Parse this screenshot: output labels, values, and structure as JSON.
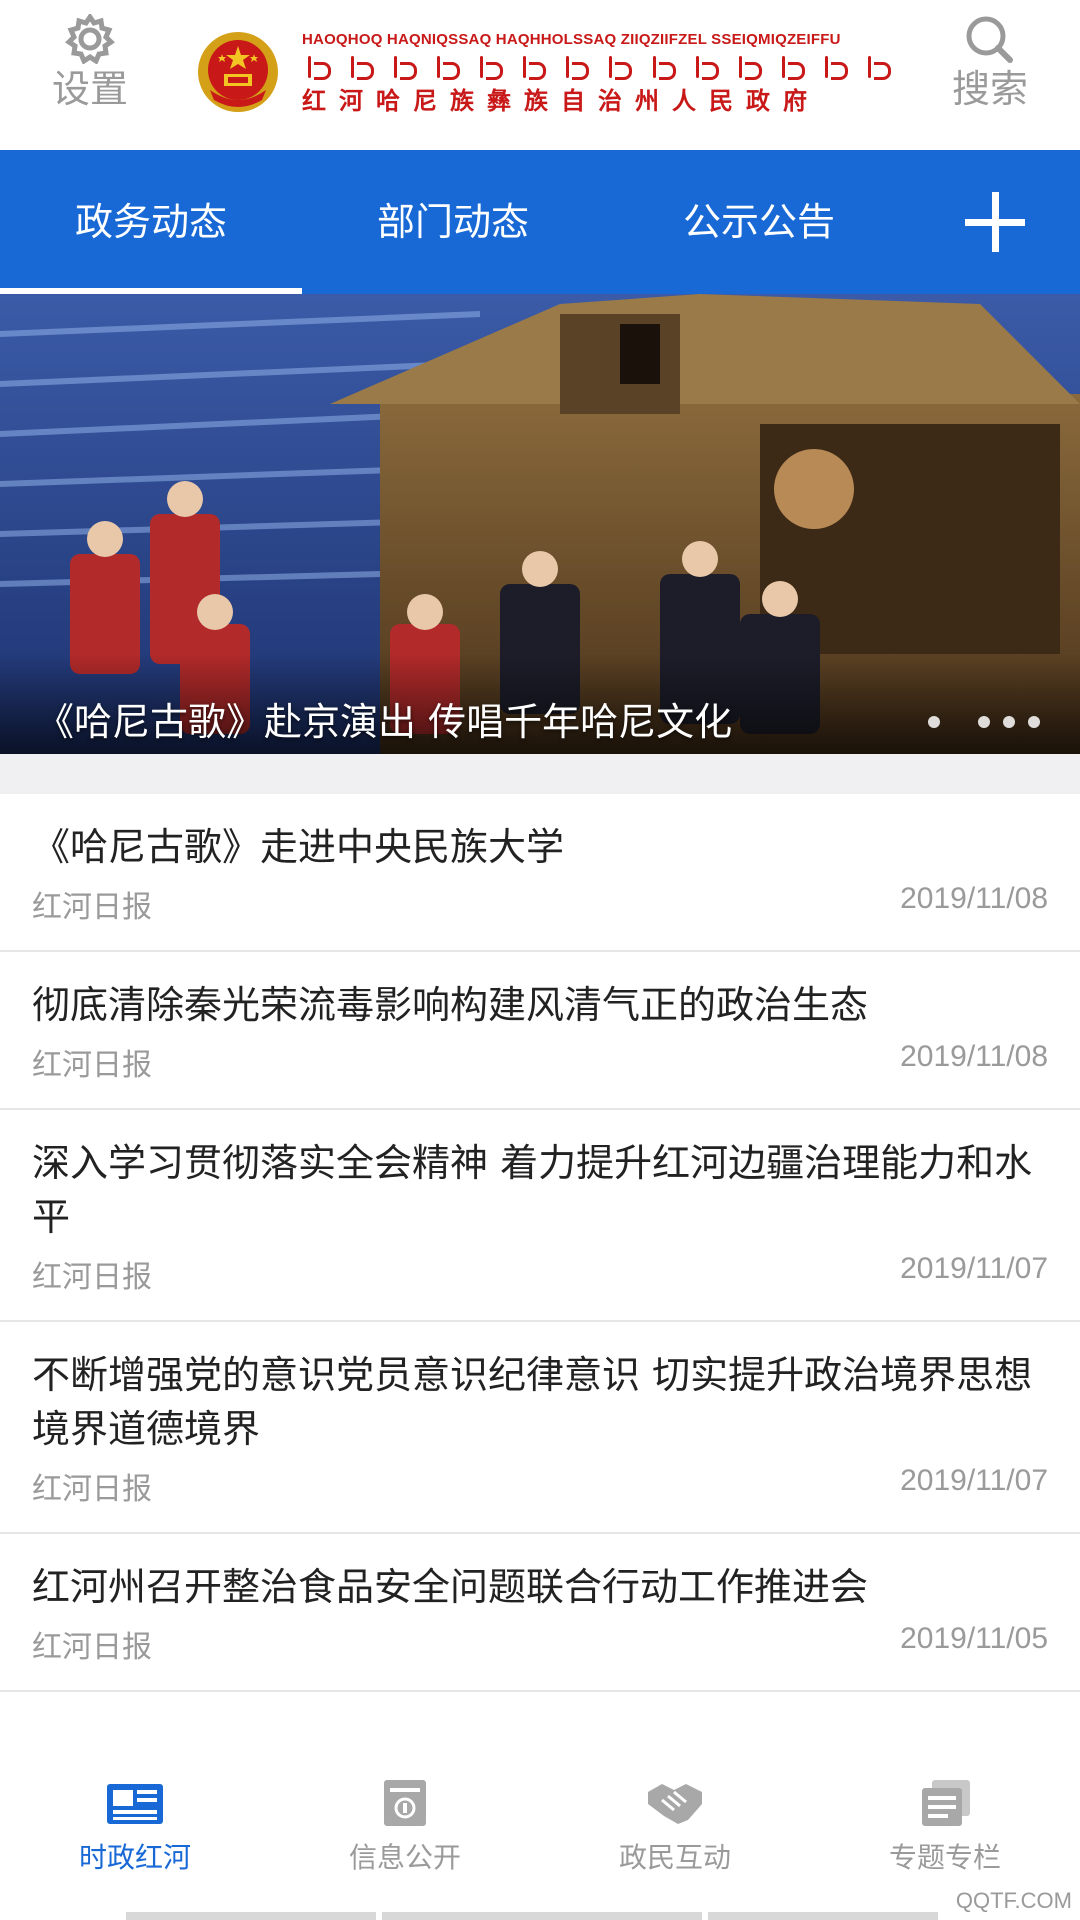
{
  "header": {
    "settings_label": "设置",
    "search_label": "搜索",
    "title_latin": "HAOQHOQ HAQNIQSSAQ HAQHHOLSSAQ ZIIQZIIFZEL SSEIQMIQZEIFFU",
    "title_cn": "红河哈尼族彝族自治州人民政府",
    "brand_red": "#c81818"
  },
  "tabs": {
    "items": [
      "政务动态",
      "部门动态",
      "公示公告"
    ],
    "active_index": 0,
    "add_icon": "plus-icon",
    "bar_color": "#1869d6"
  },
  "banner": {
    "caption": "《哈尼古歌》赴京演出 传唱千年哈尼文化",
    "dots_count": 4,
    "active_dot": 0
  },
  "news": [
    {
      "title": "《哈尼古歌》走进中央民族大学",
      "source": "红河日报",
      "date": "2019/11/08"
    },
    {
      "title": "彻底清除秦光荣流毒影响构建风清气正的政治生态",
      "source": "红河日报",
      "date": "2019/11/08"
    },
    {
      "title": "深入学习贯彻落实全会精神 着力提升红河边疆治理能力和水平",
      "source": "红河日报",
      "date": "2019/11/07"
    },
    {
      "title": "不断增强党的意识党员意识纪律意识 切实提升政治境界思想境界道德境界",
      "source": "红河日报",
      "date": "2019/11/07"
    },
    {
      "title": "红河州召开整治食品安全问题联合行动工作推进会",
      "source": "红河日报",
      "date": "2019/11/05"
    }
  ],
  "bottom_nav": {
    "items": [
      {
        "label": "时政红河",
        "icon": "newspaper-icon",
        "active": true
      },
      {
        "label": "信息公开",
        "icon": "document-icon",
        "active": false
      },
      {
        "label": "政民互动",
        "icon": "handshake-icon",
        "active": false
      },
      {
        "label": "专题专栏",
        "icon": "topics-icon",
        "active": false
      }
    ],
    "active_color": "#1869d6",
    "inactive_color": "#9a9a9a"
  },
  "watermark": "QQTF.COM"
}
